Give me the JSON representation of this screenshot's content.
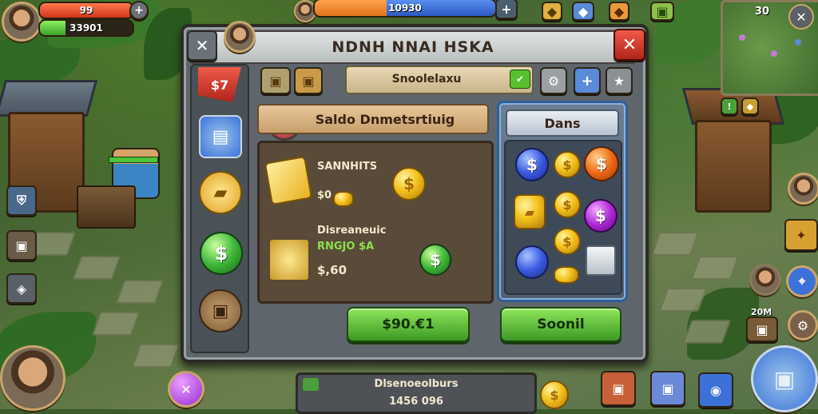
{
  "hud": {
    "player_health": "99",
    "player_gold": "33901",
    "top_resource": "10930",
    "top_counter": "30"
  },
  "dialog": {
    "title": "NDNH NNAI HSKA",
    "tab_badge": "$7",
    "search_field": "Snoolelaxu",
    "main_header": "Saldo Dnmetsrtiuig",
    "side_header": "Dans",
    "item1": {
      "name": "SANNHITS",
      "price": "$0"
    },
    "item2": {
      "name": "Disreaneuic",
      "sub": "RNGJO $A",
      "price": "$,60"
    },
    "buy_left": "$90.€1",
    "buy_right": "Soonil"
  },
  "bottom": {
    "title": "Dlsenoeolburs",
    "value": "1456 096"
  },
  "corner": {
    "counter": "20M"
  },
  "colors": {
    "bar_red": "#e0471f",
    "bar_green": "#4cc53a",
    "bar_orange": "#f08a24",
    "bar_blue": "#3c72d8",
    "button_green": "#58c030",
    "close_red": "#d9342a"
  },
  "icons": [
    "close-icon",
    "plus-icon",
    "star-icon",
    "gear-icon",
    "coin-icon",
    "chest-icon",
    "check-icon"
  ]
}
